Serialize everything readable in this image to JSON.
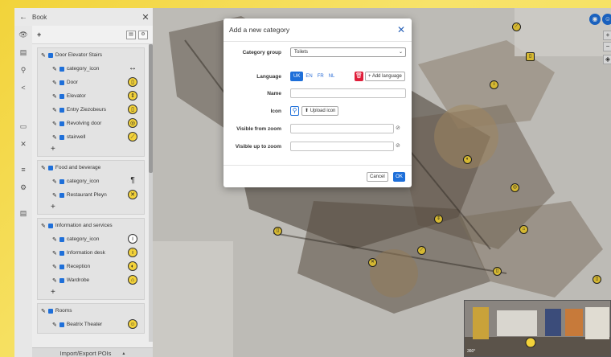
{
  "topbar": {
    "back": "←",
    "title": "Book",
    "close": "✕"
  },
  "rail": [
    "👁",
    "▤",
    "⚲",
    "<",
    "▭",
    "✕",
    "≡",
    "⚙",
    "▤"
  ],
  "sidebar": {
    "add": "+",
    "groups": [
      {
        "label": "Door Elevator Stairs",
        "items": [
          {
            "label": "category_icon",
            "icon": "↔"
          },
          {
            "label": "Door",
            "icon": "▯"
          },
          {
            "label": "Elevator",
            "icon": "⇕"
          },
          {
            "label": "Entry Ziezobeurs",
            "icon": "▯"
          },
          {
            "label": "Revolving door",
            "icon": "◎"
          },
          {
            "label": "stairwell",
            "icon": "⟋"
          }
        ],
        "add": "+"
      },
      {
        "label": "Food and beverage",
        "items": [
          {
            "label": "category_icon",
            "icon": "¶"
          },
          {
            "label": "Restaurant Pleyn",
            "icon": "✕"
          }
        ],
        "add": "+"
      },
      {
        "label": "Information and services",
        "items": [
          {
            "label": "category_icon",
            "icon": "i"
          },
          {
            "label": "Information desk",
            "icon": "i"
          },
          {
            "label": "Reception",
            "icon": "◐"
          },
          {
            "label": "Wardrobe",
            "icon": "⌂"
          }
        ],
        "add": "+"
      },
      {
        "label": "Rooms",
        "items": [
          {
            "label": "Beatrix Theater",
            "icon": "☺"
          }
        ],
        "add": ""
      }
    ],
    "bottom_label": "Import/Export POIs",
    "bottom_caret": "▴"
  },
  "modal": {
    "title": "Add a new category",
    "close": "✕",
    "category_group_label": "Category group",
    "category_group_value": "Toilets",
    "language_label": "Language",
    "languages": [
      "UK",
      "EN",
      "FR",
      "NL"
    ],
    "add_language": "+ Add language",
    "name_label": "Name",
    "icon_label": "Icon",
    "upload_icon": "⬆ Upload icon",
    "visible_from_label": "Visible from zoom",
    "visible_to_label": "Visible up to zoom",
    "cancel": "Cancel",
    "ok": "OK"
  },
  "thumb_label": "360°"
}
